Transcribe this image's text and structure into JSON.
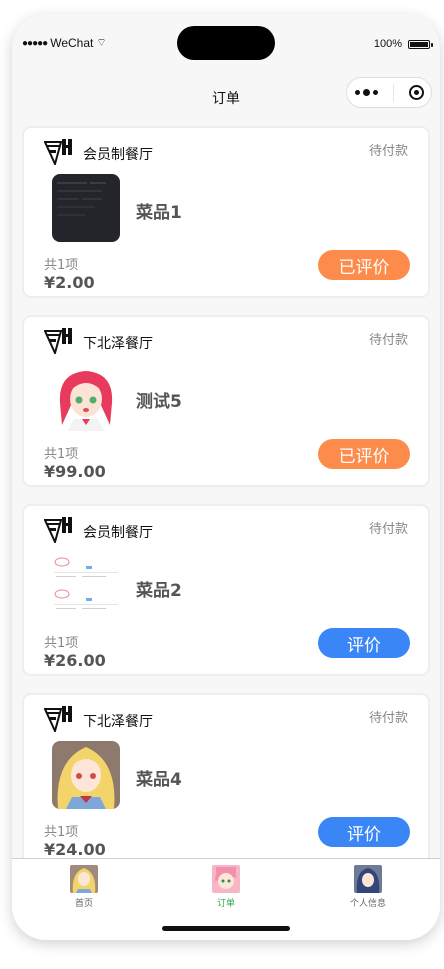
{
  "status_bar": {
    "signal": "●●●●●",
    "carrier": "WeChat",
    "wifi": "⌔",
    "battery_text": "100%",
    "battery_level": 1.0
  },
  "nav": {
    "title": "订单"
  },
  "orders": [
    {
      "shop": "会员制餐厅",
      "status": "待付款",
      "item": "菜品1",
      "count": "共1项",
      "price": "¥2.00",
      "action": "已评价",
      "action_color": "#fd8c4c"
    },
    {
      "shop": "下北泽餐厅",
      "status": "待付款",
      "item": "测试5",
      "count": "共1项",
      "price": "¥99.00",
      "action": "已评价",
      "action_color": "#fd8c4c"
    },
    {
      "shop": "会员制餐厅",
      "status": "待付款",
      "item": "菜品2",
      "count": "共1项",
      "price": "¥26.00",
      "action": "评价",
      "action_color": "#3b86f7"
    },
    {
      "shop": "下北泽餐厅",
      "status": "待付款",
      "item": "菜品4",
      "count": "共1项",
      "price": "¥24.00",
      "action": "评价",
      "action_color": "#3b86f7"
    }
  ],
  "tabs": [
    {
      "label": "首页",
      "active": false
    },
    {
      "label": "订单",
      "active": true
    },
    {
      "label": "个人信息",
      "active": false
    }
  ],
  "colors": {
    "active_tab": "#2bad4b",
    "inactive_tab": "#666666"
  }
}
